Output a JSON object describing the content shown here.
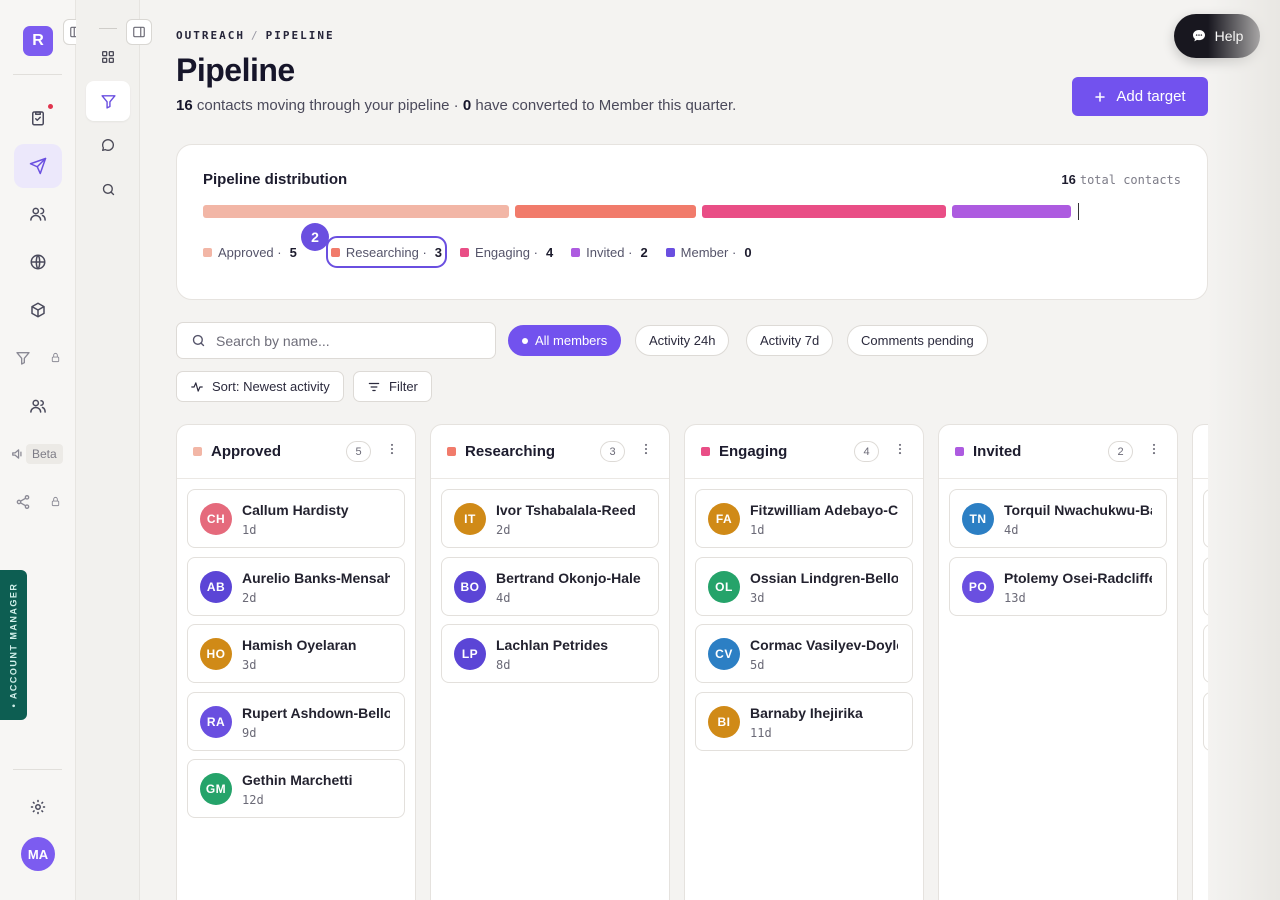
{
  "rail": {
    "logo": "R",
    "beta": "Beta",
    "account_manager": "• ACCOUNT MANAGER",
    "user_initials": "MA"
  },
  "header": {
    "breadcrumb": [
      "OUTREACH",
      "PIPELINE"
    ],
    "title": "Pipeline",
    "subtitle": {
      "contacts": "16",
      "part1": " contacts moving through your pipeline · ",
      "converted": "0",
      "part2": " have converted to Member this quarter."
    },
    "help_label": "Help",
    "add_target_label": "Add target"
  },
  "distribution": {
    "title": "Pipeline distribution",
    "total_value": "16",
    "total_label": "total contacts",
    "step_badge": "2",
    "stages": [
      {
        "name": "Approved",
        "count": 5,
        "color": "#f2b6a6"
      },
      {
        "name": "Researching",
        "count": 3,
        "color": "#f17b6b"
      },
      {
        "name": "Engaging",
        "count": 4,
        "color": "#e94e86"
      },
      {
        "name": "Invited",
        "count": 2,
        "color": "#ad5be0"
      },
      {
        "name": "Member",
        "count": 0,
        "color": "#6a4fe0"
      }
    ]
  },
  "toolbar": {
    "search_placeholder": "Search by name...",
    "chips": [
      "All members",
      "Activity 24h",
      "Activity 7d",
      "Comments pending"
    ],
    "sort_label": "Sort: Newest activity",
    "filter_label": "Filter"
  },
  "columns": [
    {
      "name": "Approved",
      "count": "5",
      "color": "#f2b6a6",
      "cards": [
        {
          "initials": "CH",
          "name": "Callum Hardisty",
          "age": "1d",
          "color": "#e56a7c"
        },
        {
          "initials": "AB",
          "name": "Aurelio Banks-Mensah",
          "age": "2d",
          "color": "#5b45d6"
        },
        {
          "initials": "HO",
          "name": "Hamish Oyelaran",
          "age": "3d",
          "color": "#d08a17"
        },
        {
          "initials": "RA",
          "name": "Rupert Ashdown-Bello",
          "age": "9d",
          "color": "#6a4fe0"
        },
        {
          "initials": "GM",
          "name": "Gethin Marchetti",
          "age": "12d",
          "color": "#25a36a"
        }
      ]
    },
    {
      "name": "Researching",
      "count": "3",
      "color": "#f17b6b",
      "cards": [
        {
          "initials": "IT",
          "name": "Ivor Tshabalala-Reed",
          "age": "2d",
          "color": "#d08a17"
        },
        {
          "initials": "BO",
          "name": "Bertrand Okonjo-Hale",
          "age": "4d",
          "color": "#5b45d6"
        },
        {
          "initials": "LP",
          "name": "Lachlan Petrides",
          "age": "8d",
          "color": "#5b45d6"
        }
      ]
    },
    {
      "name": "Engaging",
      "count": "4",
      "color": "#e94e86",
      "cards": [
        {
          "initials": "FA",
          "name": "Fitzwilliam Adebayo-Cole",
          "age": "1d",
          "color": "#d08a17"
        },
        {
          "initials": "OL",
          "name": "Ossian Lindgren-Bello",
          "age": "3d",
          "color": "#25a36a"
        },
        {
          "initials": "CV",
          "name": "Cormac Vasilyev-Doyle",
          "age": "5d",
          "color": "#2c7fc4"
        },
        {
          "initials": "BI",
          "name": "Barnaby Ihejirika",
          "age": "11d",
          "color": "#d08a17"
        }
      ]
    },
    {
      "name": "Invited",
      "count": "2",
      "color": "#ad5be0",
      "cards": [
        {
          "initials": "TN",
          "name": "Torquil Nwachukwu-Bates",
          "age": "4d",
          "color": "#2c7fc4"
        },
        {
          "initials": "PO",
          "name": "Ptolemy Osei-Radcliffe",
          "age": "13d",
          "color": "#6a4fe0"
        }
      ]
    }
  ]
}
